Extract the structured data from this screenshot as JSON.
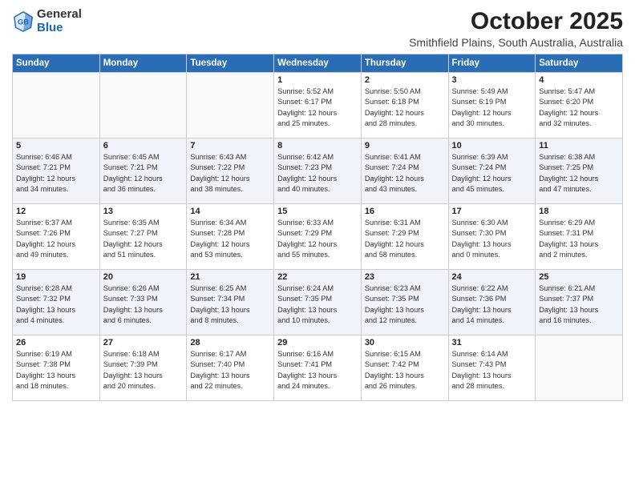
{
  "logo": {
    "general": "General",
    "blue": "Blue"
  },
  "header": {
    "month": "October 2025",
    "location": "Smithfield Plains, South Australia, Australia"
  },
  "weekdays": [
    "Sunday",
    "Monday",
    "Tuesday",
    "Wednesday",
    "Thursday",
    "Friday",
    "Saturday"
  ],
  "weeks": [
    [
      {
        "day": "",
        "info": ""
      },
      {
        "day": "",
        "info": ""
      },
      {
        "day": "",
        "info": ""
      },
      {
        "day": "1",
        "info": "Sunrise: 5:52 AM\nSunset: 6:17 PM\nDaylight: 12 hours\nand 25 minutes."
      },
      {
        "day": "2",
        "info": "Sunrise: 5:50 AM\nSunset: 6:18 PM\nDaylight: 12 hours\nand 28 minutes."
      },
      {
        "day": "3",
        "info": "Sunrise: 5:49 AM\nSunset: 6:19 PM\nDaylight: 12 hours\nand 30 minutes."
      },
      {
        "day": "4",
        "info": "Sunrise: 5:47 AM\nSunset: 6:20 PM\nDaylight: 12 hours\nand 32 minutes."
      }
    ],
    [
      {
        "day": "5",
        "info": "Sunrise: 6:46 AM\nSunset: 7:21 PM\nDaylight: 12 hours\nand 34 minutes."
      },
      {
        "day": "6",
        "info": "Sunrise: 6:45 AM\nSunset: 7:21 PM\nDaylight: 12 hours\nand 36 minutes."
      },
      {
        "day": "7",
        "info": "Sunrise: 6:43 AM\nSunset: 7:22 PM\nDaylight: 12 hours\nand 38 minutes."
      },
      {
        "day": "8",
        "info": "Sunrise: 6:42 AM\nSunset: 7:23 PM\nDaylight: 12 hours\nand 40 minutes."
      },
      {
        "day": "9",
        "info": "Sunrise: 6:41 AM\nSunset: 7:24 PM\nDaylight: 12 hours\nand 43 minutes."
      },
      {
        "day": "10",
        "info": "Sunrise: 6:39 AM\nSunset: 7:24 PM\nDaylight: 12 hours\nand 45 minutes."
      },
      {
        "day": "11",
        "info": "Sunrise: 6:38 AM\nSunset: 7:25 PM\nDaylight: 12 hours\nand 47 minutes."
      }
    ],
    [
      {
        "day": "12",
        "info": "Sunrise: 6:37 AM\nSunset: 7:26 PM\nDaylight: 12 hours\nand 49 minutes."
      },
      {
        "day": "13",
        "info": "Sunrise: 6:35 AM\nSunset: 7:27 PM\nDaylight: 12 hours\nand 51 minutes."
      },
      {
        "day": "14",
        "info": "Sunrise: 6:34 AM\nSunset: 7:28 PM\nDaylight: 12 hours\nand 53 minutes."
      },
      {
        "day": "15",
        "info": "Sunrise: 6:33 AM\nSunset: 7:29 PM\nDaylight: 12 hours\nand 55 minutes."
      },
      {
        "day": "16",
        "info": "Sunrise: 6:31 AM\nSunset: 7:29 PM\nDaylight: 12 hours\nand 58 minutes."
      },
      {
        "day": "17",
        "info": "Sunrise: 6:30 AM\nSunset: 7:30 PM\nDaylight: 13 hours\nand 0 minutes."
      },
      {
        "day": "18",
        "info": "Sunrise: 6:29 AM\nSunset: 7:31 PM\nDaylight: 13 hours\nand 2 minutes."
      }
    ],
    [
      {
        "day": "19",
        "info": "Sunrise: 6:28 AM\nSunset: 7:32 PM\nDaylight: 13 hours\nand 4 minutes."
      },
      {
        "day": "20",
        "info": "Sunrise: 6:26 AM\nSunset: 7:33 PM\nDaylight: 13 hours\nand 6 minutes."
      },
      {
        "day": "21",
        "info": "Sunrise: 6:25 AM\nSunset: 7:34 PM\nDaylight: 13 hours\nand 8 minutes."
      },
      {
        "day": "22",
        "info": "Sunrise: 6:24 AM\nSunset: 7:35 PM\nDaylight: 13 hours\nand 10 minutes."
      },
      {
        "day": "23",
        "info": "Sunrise: 6:23 AM\nSunset: 7:35 PM\nDaylight: 13 hours\nand 12 minutes."
      },
      {
        "day": "24",
        "info": "Sunrise: 6:22 AM\nSunset: 7:36 PM\nDaylight: 13 hours\nand 14 minutes."
      },
      {
        "day": "25",
        "info": "Sunrise: 6:21 AM\nSunset: 7:37 PM\nDaylight: 13 hours\nand 16 minutes."
      }
    ],
    [
      {
        "day": "26",
        "info": "Sunrise: 6:19 AM\nSunset: 7:38 PM\nDaylight: 13 hours\nand 18 minutes."
      },
      {
        "day": "27",
        "info": "Sunrise: 6:18 AM\nSunset: 7:39 PM\nDaylight: 13 hours\nand 20 minutes."
      },
      {
        "day": "28",
        "info": "Sunrise: 6:17 AM\nSunset: 7:40 PM\nDaylight: 13 hours\nand 22 minutes."
      },
      {
        "day": "29",
        "info": "Sunrise: 6:16 AM\nSunset: 7:41 PM\nDaylight: 13 hours\nand 24 minutes."
      },
      {
        "day": "30",
        "info": "Sunrise: 6:15 AM\nSunset: 7:42 PM\nDaylight: 13 hours\nand 26 minutes."
      },
      {
        "day": "31",
        "info": "Sunrise: 6:14 AM\nSunset: 7:43 PM\nDaylight: 13 hours\nand 28 minutes."
      },
      {
        "day": "",
        "info": ""
      }
    ]
  ]
}
